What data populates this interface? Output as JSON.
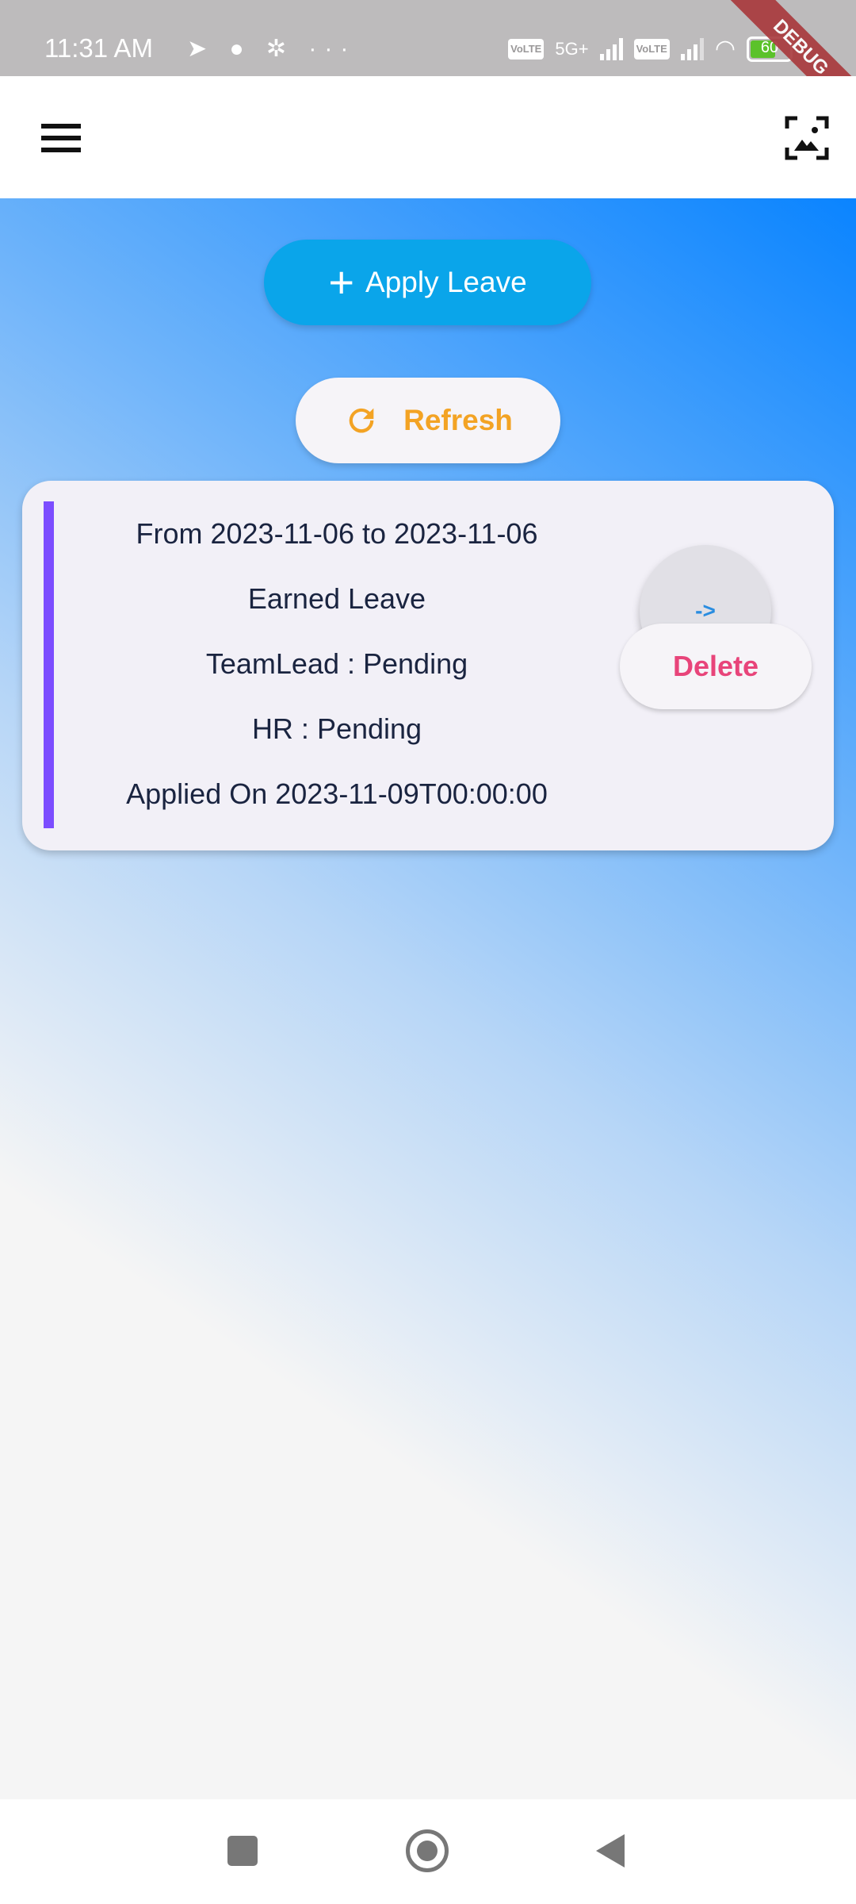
{
  "status_bar": {
    "time": "11:31 AM",
    "notification_icons": [
      "telegram-icon",
      "chat-icon",
      "android-debug-icon",
      "more-icon"
    ],
    "network": [
      "VoLTE",
      "5G+",
      "VoLTE"
    ],
    "battery": "60"
  },
  "debug_banner": "DEBUG",
  "app_bar": {
    "menu_icon": "hamburger-menu-icon",
    "action_icon": "image-frame-icon"
  },
  "actions": {
    "apply_leave": "Apply Leave",
    "refresh": "Refresh"
  },
  "leaves": [
    {
      "range": "From 2023-11-06 to 2023-11-06",
      "type": "Earned Leave",
      "teamlead": "TeamLead : Pending",
      "hr": "HR : Pending",
      "applied": "Applied On 2023-11-09T00:00:00",
      "open_label": "->",
      "delete_label": "Delete"
    }
  ],
  "colors": {
    "apply": "#0aa5ea",
    "refresh": "#f3a324",
    "accent": "#7c4dff",
    "delete": "#e8447a"
  }
}
